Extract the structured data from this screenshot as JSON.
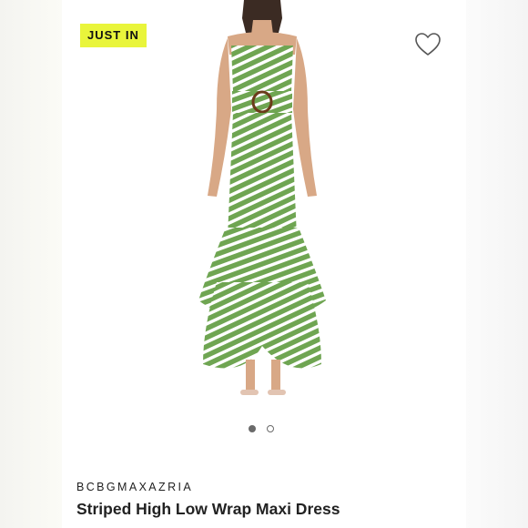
{
  "badge": {
    "label": "JUST IN",
    "color": "#e9f53b"
  },
  "icons": {
    "favorite": "heart-outline-icon"
  },
  "product": {
    "brand": "BCBGMAXAZRIA",
    "title": "Striped High Low Wrap Maxi Dress",
    "dress_color": "#6fa552",
    "stripe_color": "#ffffff"
  },
  "carousel": {
    "count": 2,
    "active": 1
  }
}
